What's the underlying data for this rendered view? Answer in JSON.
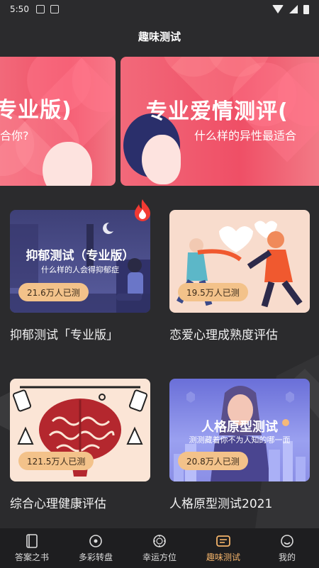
{
  "status_bar": {
    "time": "5:50"
  },
  "header": {
    "title": "趣味测试"
  },
  "banner": {
    "left_title": "专业版)",
    "left_sub": "合你?",
    "right_title": "专业爱情测评(",
    "right_sub": "什么样的异性最适合"
  },
  "cards": [
    {
      "title": "抑郁测试（专业版）",
      "subtitle": "什么样的人会得抑郁症",
      "count": "21.6万人已测",
      "caption": "抑郁测试「专业版」"
    },
    {
      "title": "",
      "subtitle": "",
      "count": "19.5万人已测",
      "caption": "恋爱心理成熟度评估"
    },
    {
      "title": "",
      "subtitle": "",
      "count": "121.5万人已测",
      "caption": "综合心理健康评估"
    },
    {
      "title": "人格原型测试",
      "subtitle": "测测藏着你不为人知的哪一面",
      "count": "20.8万人已测",
      "caption": "人格原型测试2021"
    }
  ],
  "nav": [
    {
      "label": "答案之书",
      "icon": "book-icon"
    },
    {
      "label": "多彩转盘",
      "icon": "dial-icon"
    },
    {
      "label": "幸运方位",
      "icon": "compass-icon"
    },
    {
      "label": "趣味测试",
      "icon": "test-icon"
    },
    {
      "label": "我的",
      "icon": "profile-icon"
    }
  ],
  "colors": {
    "accent": "#f3b36a",
    "background": "#2b2b2d",
    "badge": "#f3c28a"
  }
}
